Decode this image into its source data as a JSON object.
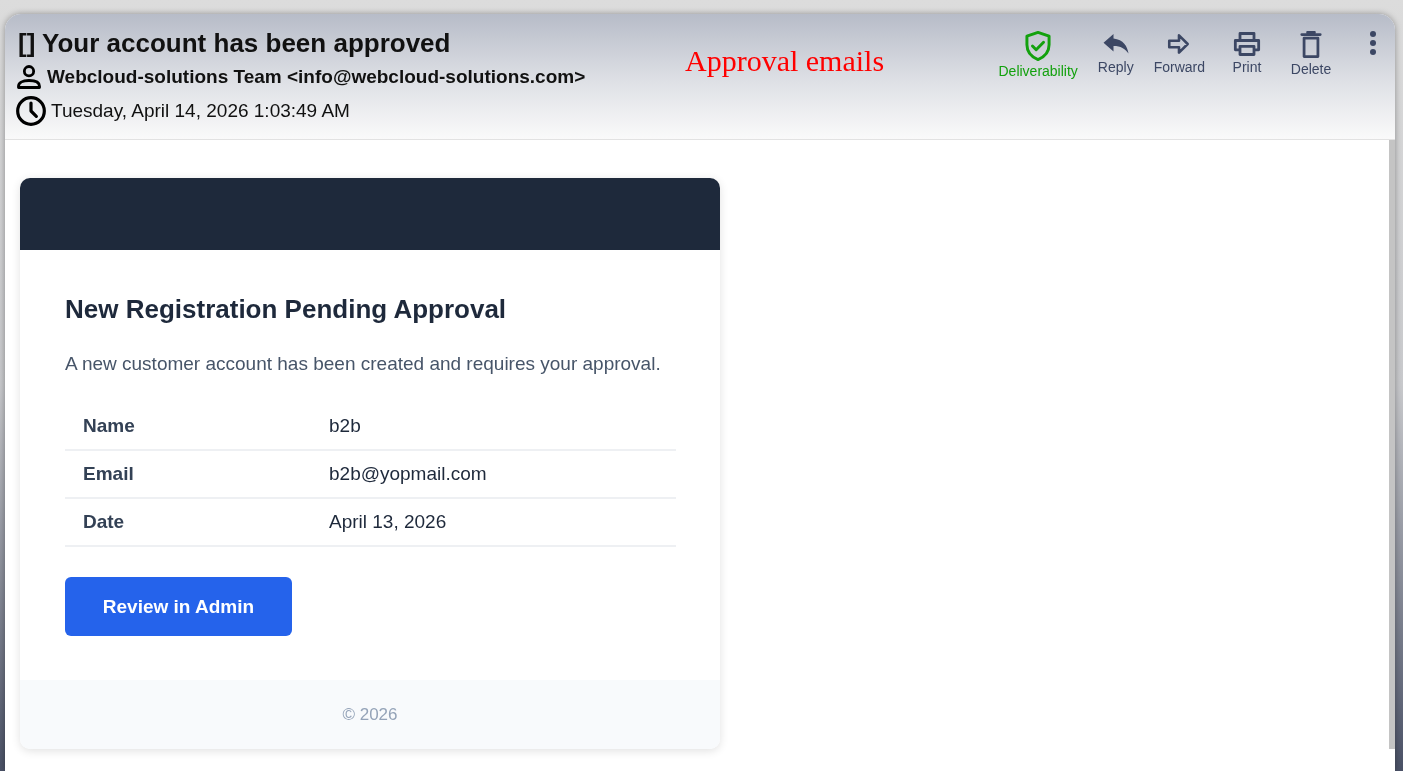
{
  "email": {
    "subject": "[] Your account has been approved",
    "sender": "Webcloud-solutions Team <info@webcloud-solutions.com>",
    "date": "Tuesday, April 14, 2026 1:03:49 AM"
  },
  "annotation": "Approval emails",
  "actions": [
    {
      "label": "Deliverability",
      "kind": "status"
    },
    {
      "label": "Reply",
      "kind": "action"
    },
    {
      "label": "Forward",
      "kind": "action"
    },
    {
      "label": "Print",
      "kind": "action"
    },
    {
      "label": "Delete",
      "kind": "action"
    }
  ],
  "message": {
    "heading": "New Registration Pending Approval",
    "intro": "A new customer account has been created and requires your approval.",
    "details": [
      {
        "label": "Name",
        "value": "b2b"
      },
      {
        "label": "Email",
        "value": "b2b@yopmail.com"
      },
      {
        "label": "Date",
        "value": "April 13, 2026"
      }
    ],
    "button": "Review in Admin",
    "footer": "© 2026"
  }
}
